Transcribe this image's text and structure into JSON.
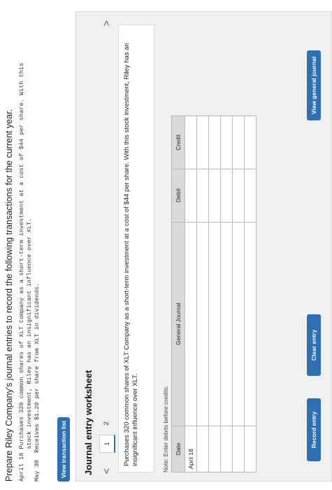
{
  "instructions": {
    "intro": "Prepare Riley Company's journal entries to record the following transactions for the current year.",
    "transactions": [
      "April 18 Purchases 320 common shares of XLT Company as a short-term investment at a cost of $44 per share. With this",
      "         stock investment, Riley has an insignificant influence over XLT.",
      "May 30  Receives $1.20 per share from XLT in dividends."
    ]
  },
  "view_transaction_list_label": "View transaction list",
  "worksheet": {
    "title": "Journal entry worksheet",
    "prev_symbol": "<",
    "next_symbol": ">",
    "steps": [
      "1",
      "2"
    ],
    "active_step": "1",
    "description": "Purchases 320 common shares of XLT Company as a short-term investment at a cost of $44 per share. With this stock investment, Riley has an insignificant influence over XLT.",
    "note": "Note: Enter debits before credits.",
    "table": {
      "headers": [
        "Date",
        "General Journal",
        "Debit",
        "Credit"
      ],
      "rows": [
        [
          "April 18",
          "",
          "",
          ""
        ],
        [
          "",
          "",
          "",
          ""
        ],
        [
          "",
          "",
          "",
          ""
        ],
        [
          "",
          "",
          "",
          ""
        ],
        [
          "",
          "",
          "",
          ""
        ],
        [
          "",
          "",
          "",
          ""
        ]
      ]
    },
    "buttons": {
      "record": "Record entry",
      "clear": "Clear entry",
      "view_general_journal": "View general journal"
    }
  },
  "colors": {
    "accent": "#2f6fb3",
    "panel_bg": "#f0f0f0",
    "header_bg": "#d9d9d9"
  }
}
